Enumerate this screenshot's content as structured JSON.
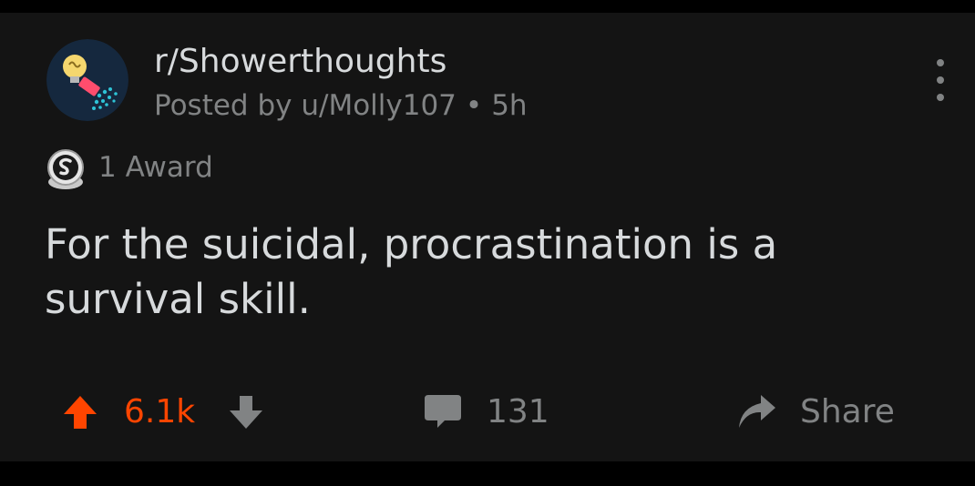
{
  "post": {
    "subreddit": "r/Showerthoughts",
    "posted_by_prefix": "Posted by",
    "author": "u/Molly107",
    "separator": "•",
    "age": "5h",
    "awards_label": "1 Award",
    "title": "For the suicidal, procrastination is a survival skill.",
    "score": "6.1k",
    "comment_count": "131",
    "share_label": "Share"
  },
  "icons": {
    "avatar": "showerthoughts-avatar-icon",
    "more": "more-options-icon",
    "award": "silver-award-icon",
    "upvote": "upvote-arrow-icon",
    "downvote": "downvote-arrow-icon",
    "comment": "comment-bubble-icon",
    "share": "share-arrow-icon"
  },
  "colors": {
    "background": "#141414",
    "primary_text": "#d7dadc",
    "secondary_text": "#818384",
    "upvote_active": "#ff4500",
    "avatar_bg": "#15283e"
  }
}
